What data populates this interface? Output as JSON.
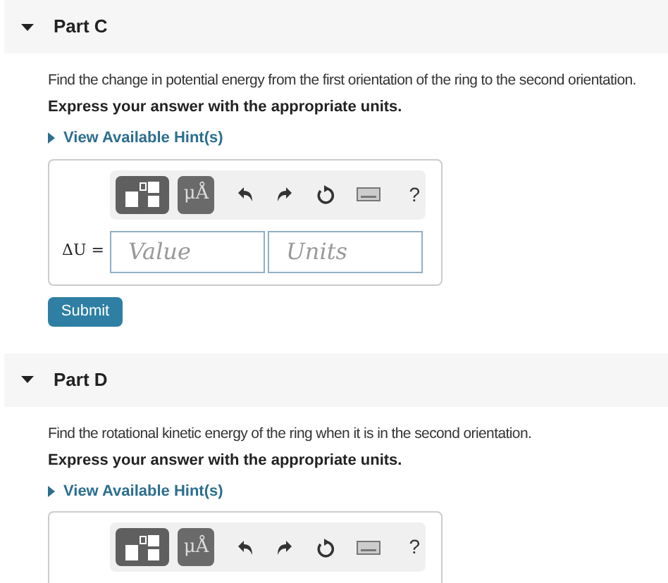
{
  "parts": [
    {
      "title": "Part C",
      "expanded": true,
      "question": "Find the change in potential energy from the first orientation of the ring to the second orientation.",
      "instruction": "Express your answer with the appropriate units.",
      "hint_link": "View Available Hint(s)",
      "toolbar": {
        "units_button": "μÅ",
        "help_button": "?"
      },
      "answer": {
        "label": "ΔU =",
        "value_placeholder": "Value",
        "units_placeholder": "Units"
      },
      "submit": "Submit"
    },
    {
      "title": "Part D",
      "expanded": true,
      "question": "Find the rotational kinetic energy of the ring when it is in the second orientation.",
      "instruction": "Express your answer with the appropriate units.",
      "hint_link": "View Available Hint(s)",
      "toolbar": {
        "units_button": "μÅ",
        "help_button": "?"
      }
    }
  ]
}
